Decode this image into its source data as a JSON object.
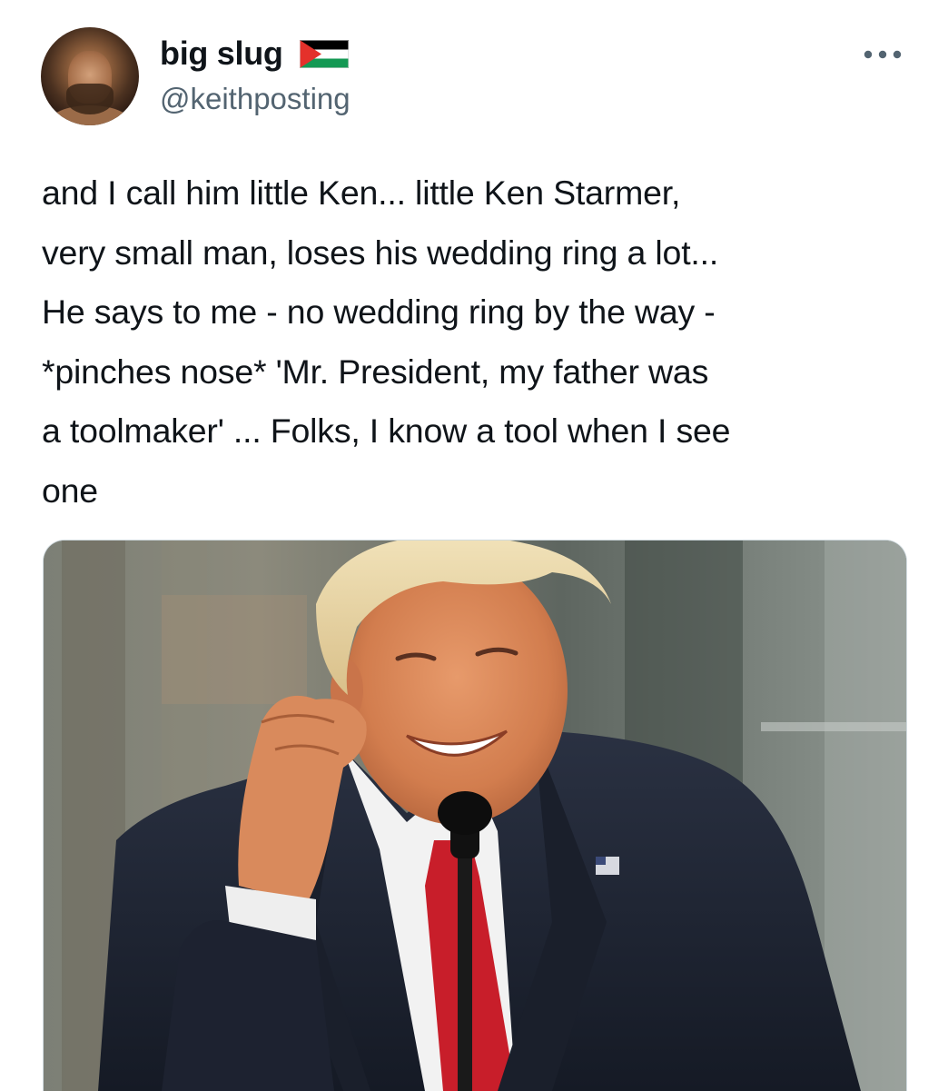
{
  "author": {
    "display_name": "big slug",
    "handle": "@keithposting",
    "flag_icon": "palestine-flag-icon",
    "avatar_icon": "profile-photo-bearded-man"
  },
  "menu": {
    "icon": "more-options-icon"
  },
  "tweet": {
    "lines": [
      "and I call him little Ken... little Ken Starmer,",
      "very small man, loses his wedding ring a lot...",
      "He says to me - no wedding ring by the way -",
      "*pinches nose* 'Mr. President, my father was",
      "a toolmaker' ... Folks, I know a tool when I see",
      "one"
    ]
  },
  "media": {
    "description_icon": "photo-man-in-suit-at-microphone"
  },
  "colors": {
    "text_primary": "#0f1419",
    "text_secondary": "#536471",
    "border": "#cfd9de"
  }
}
